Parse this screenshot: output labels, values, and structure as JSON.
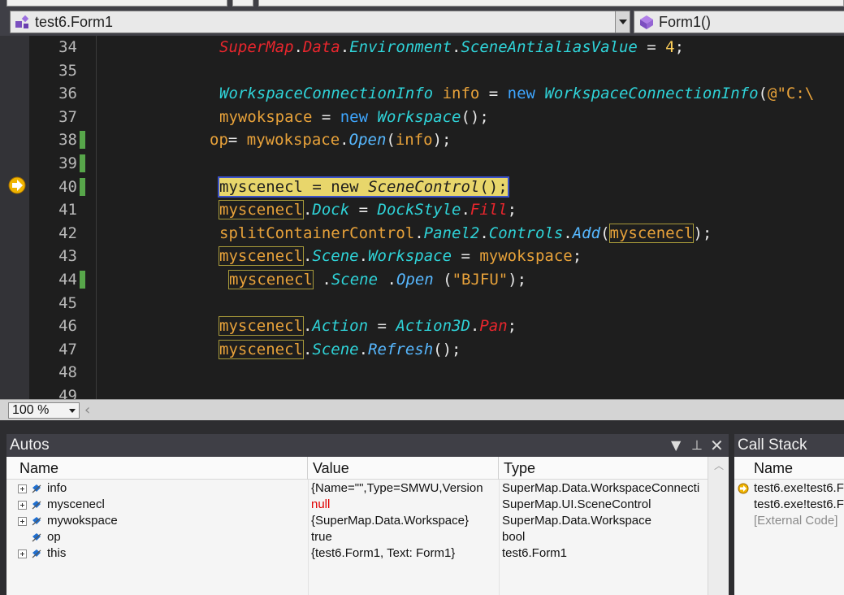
{
  "navigation": {
    "class_combo": "test6.Form1",
    "member_combo": "Form1()"
  },
  "editor": {
    "lines": [
      {
        "num": "34",
        "changed": false
      },
      {
        "num": "35",
        "changed": false
      },
      {
        "num": "36",
        "changed": false
      },
      {
        "num": "37",
        "changed": false
      },
      {
        "num": "38",
        "changed": true
      },
      {
        "num": "39",
        "changed": true
      },
      {
        "num": "40",
        "changed": true
      },
      {
        "num": "41",
        "changed": false
      },
      {
        "num": "42",
        "changed": false
      },
      {
        "num": "43",
        "changed": false
      },
      {
        "num": "44",
        "changed": true
      },
      {
        "num": "45",
        "changed": false
      },
      {
        "num": "46",
        "changed": false
      },
      {
        "num": "47",
        "changed": false
      },
      {
        "num": "48",
        "changed": false
      },
      {
        "num": "49",
        "changed": false
      }
    ],
    "code": {
      "l34": [
        "SuperMap",
        ".",
        "Data",
        ".",
        "Environment",
        ".",
        "SceneAntialiasValue",
        " = ",
        "4",
        ";"
      ],
      "l36": [
        "WorkspaceConnectionInfo",
        " ",
        "info",
        " = ",
        "new",
        " ",
        "WorkspaceConnectionInfo",
        "(",
        "@\"C:\\"
      ],
      "l37": [
        "mywokspace",
        " = ",
        "new",
        " ",
        "Workspace",
        "();"
      ],
      "l38": [
        "op",
        "= ",
        "mywokspace",
        ".",
        "Open",
        "(",
        "info",
        ");"
      ],
      "l40": [
        "myscenecl",
        " = ",
        "new",
        " ",
        "SceneControl",
        "();"
      ],
      "l41": [
        "myscenecl",
        ".",
        "Dock",
        " = ",
        "DockStyle",
        ".",
        "Fill",
        ";"
      ],
      "l42": [
        "splitContainerControl",
        ".",
        "Panel2",
        ".",
        "Controls",
        ".",
        "Add",
        "(",
        "myscenecl",
        ");"
      ],
      "l43": [
        "myscenecl",
        ".",
        "Scene",
        ".",
        "Workspace",
        " = ",
        "mywokspace",
        ";"
      ],
      "l44": [
        "myscenecl",
        " .",
        "Scene",
        " .",
        "Open",
        " (",
        "\"BJFU\"",
        ");"
      ],
      "l46": [
        "myscenecl",
        ".",
        "Action",
        " = ",
        "Action3D",
        ".",
        "Pan",
        ";"
      ],
      "l47": [
        "myscenecl",
        ".",
        "Scene",
        ".",
        "Refresh",
        "();"
      ]
    }
  },
  "zoom": {
    "value": "100 %"
  },
  "autos": {
    "title": "Autos",
    "columns": [
      "Name",
      "Value",
      "Type"
    ],
    "rows": [
      {
        "name": "info",
        "value": "{Name=\"\",Type=SMWU,Version",
        "type": "SuperMap.Data.WorkspaceConnecti",
        "expandable": true,
        "value_color": "#111111"
      },
      {
        "name": "myscenecl",
        "value": "null",
        "type": "SuperMap.UI.SceneControl",
        "expandable": true,
        "value_color": "#e00000"
      },
      {
        "name": "mywokspace",
        "value": "{SuperMap.Data.Workspace}",
        "type": "SuperMap.Data.Workspace",
        "expandable": true,
        "value_color": "#111111"
      },
      {
        "name": "op",
        "value": "true",
        "type": "bool",
        "expandable": false,
        "value_color": "#111111"
      },
      {
        "name": "this",
        "value": "{test6.Form1, Text: Form1}",
        "type": "test6.Form1",
        "expandable": true,
        "value_color": "#111111"
      }
    ]
  },
  "callstack": {
    "title": "Call Stack",
    "columns": [
      "Name"
    ],
    "rows": [
      {
        "name": "test6.exe!test6.F",
        "current": true
      },
      {
        "name": "test6.exe!test6.F",
        "current": false
      },
      {
        "name": "[External Code]",
        "current": false
      }
    ]
  },
  "colors": {
    "accent_changed": "#57a64a",
    "current_statement": "#e8d66b",
    "error_value": "#e00000"
  }
}
